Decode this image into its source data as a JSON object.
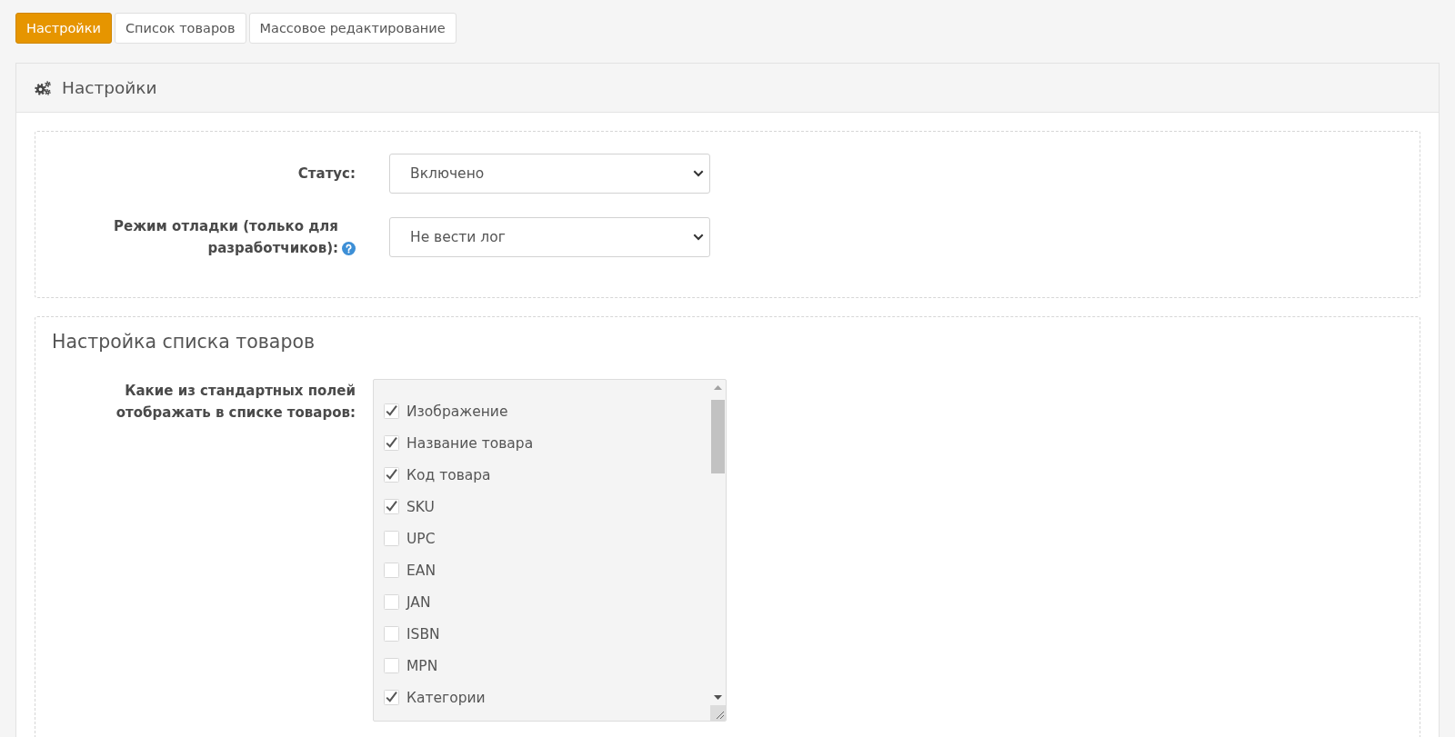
{
  "tabs": [
    {
      "label": "Настройки",
      "selected": true
    },
    {
      "label": "Список товаров",
      "selected": false
    },
    {
      "label": "Массовое редактирование",
      "selected": false
    }
  ],
  "panel": {
    "title": "Настройки"
  },
  "general_settings": {
    "fields": [
      {
        "label": "Статус:",
        "value": "Включено",
        "help": false
      },
      {
        "label": "Режим отладки (только для разработчиков):",
        "value": "Не вести лог",
        "help": true
      }
    ]
  },
  "product_list_settings": {
    "title": "Настройка списка товаров",
    "fields_label": "Какие из стандартных полей отображать в списке товаров:",
    "options": [
      {
        "label": "Изображение",
        "checked": true
      },
      {
        "label": "Название товара",
        "checked": true
      },
      {
        "label": "Код товара",
        "checked": true
      },
      {
        "label": "SKU",
        "checked": true
      },
      {
        "label": "UPC",
        "checked": false
      },
      {
        "label": "EAN",
        "checked": false
      },
      {
        "label": "JAN",
        "checked": false
      },
      {
        "label": "ISBN",
        "checked": false
      },
      {
        "label": "MPN",
        "checked": false
      },
      {
        "label": "Категории",
        "checked": true
      }
    ]
  }
}
